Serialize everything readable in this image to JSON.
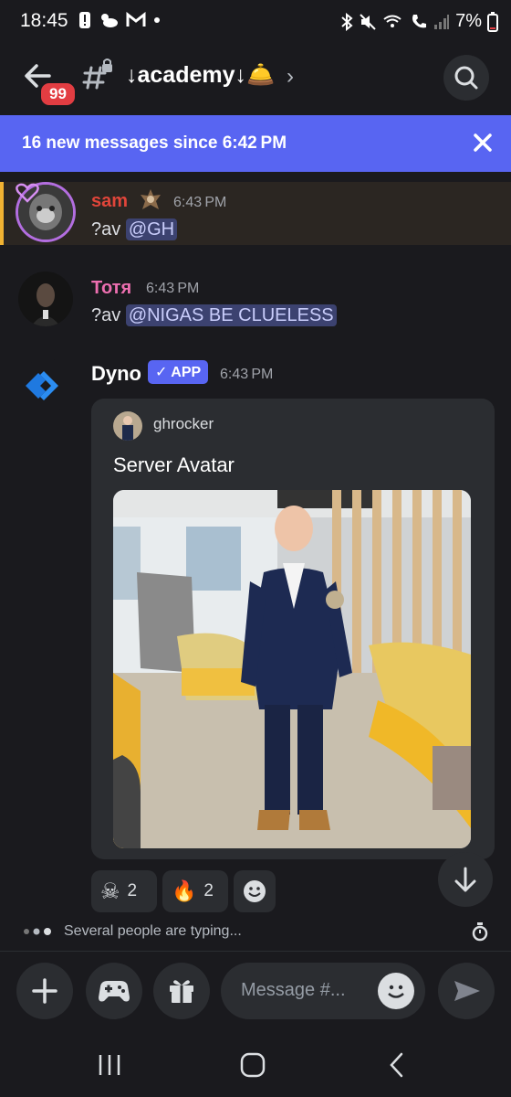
{
  "status_bar": {
    "time": "18:45",
    "battery": "7%"
  },
  "header": {
    "notification_count": "99",
    "channel_name": "↓academy↓🛎️"
  },
  "new_messages_bar": {
    "text": "16 new messages since 6:42 PM"
  },
  "messages": [
    {
      "username": "sam",
      "time": "6:43 PM",
      "prefix": "?av",
      "mention": "@GH",
      "name_color": "#e0453a"
    },
    {
      "username": "Тотя",
      "time": "6:43 PM",
      "prefix": "?av",
      "mention": "@NIGAS BE CLUELESS",
      "name_color": "#ed6fb0"
    },
    {
      "username": "Dyno",
      "badge": "✓ APP",
      "time": "6:43 PM",
      "name_color": "#ffffff"
    }
  ],
  "embed": {
    "author": "ghrocker",
    "title": "Server Avatar"
  },
  "reactions": [
    {
      "emoji": "skull-crossbones",
      "count": "2"
    },
    {
      "emoji": "fire",
      "count": "2"
    }
  ],
  "typing_indicator": "Several people are typing...",
  "composer": {
    "placeholder": "Message #..."
  },
  "colors": {
    "accent": "#5865f2",
    "background": "#1a1a1e",
    "surface": "#2b2d31",
    "badge_red": "#e23d42",
    "highlight_border": "#f0b232"
  }
}
